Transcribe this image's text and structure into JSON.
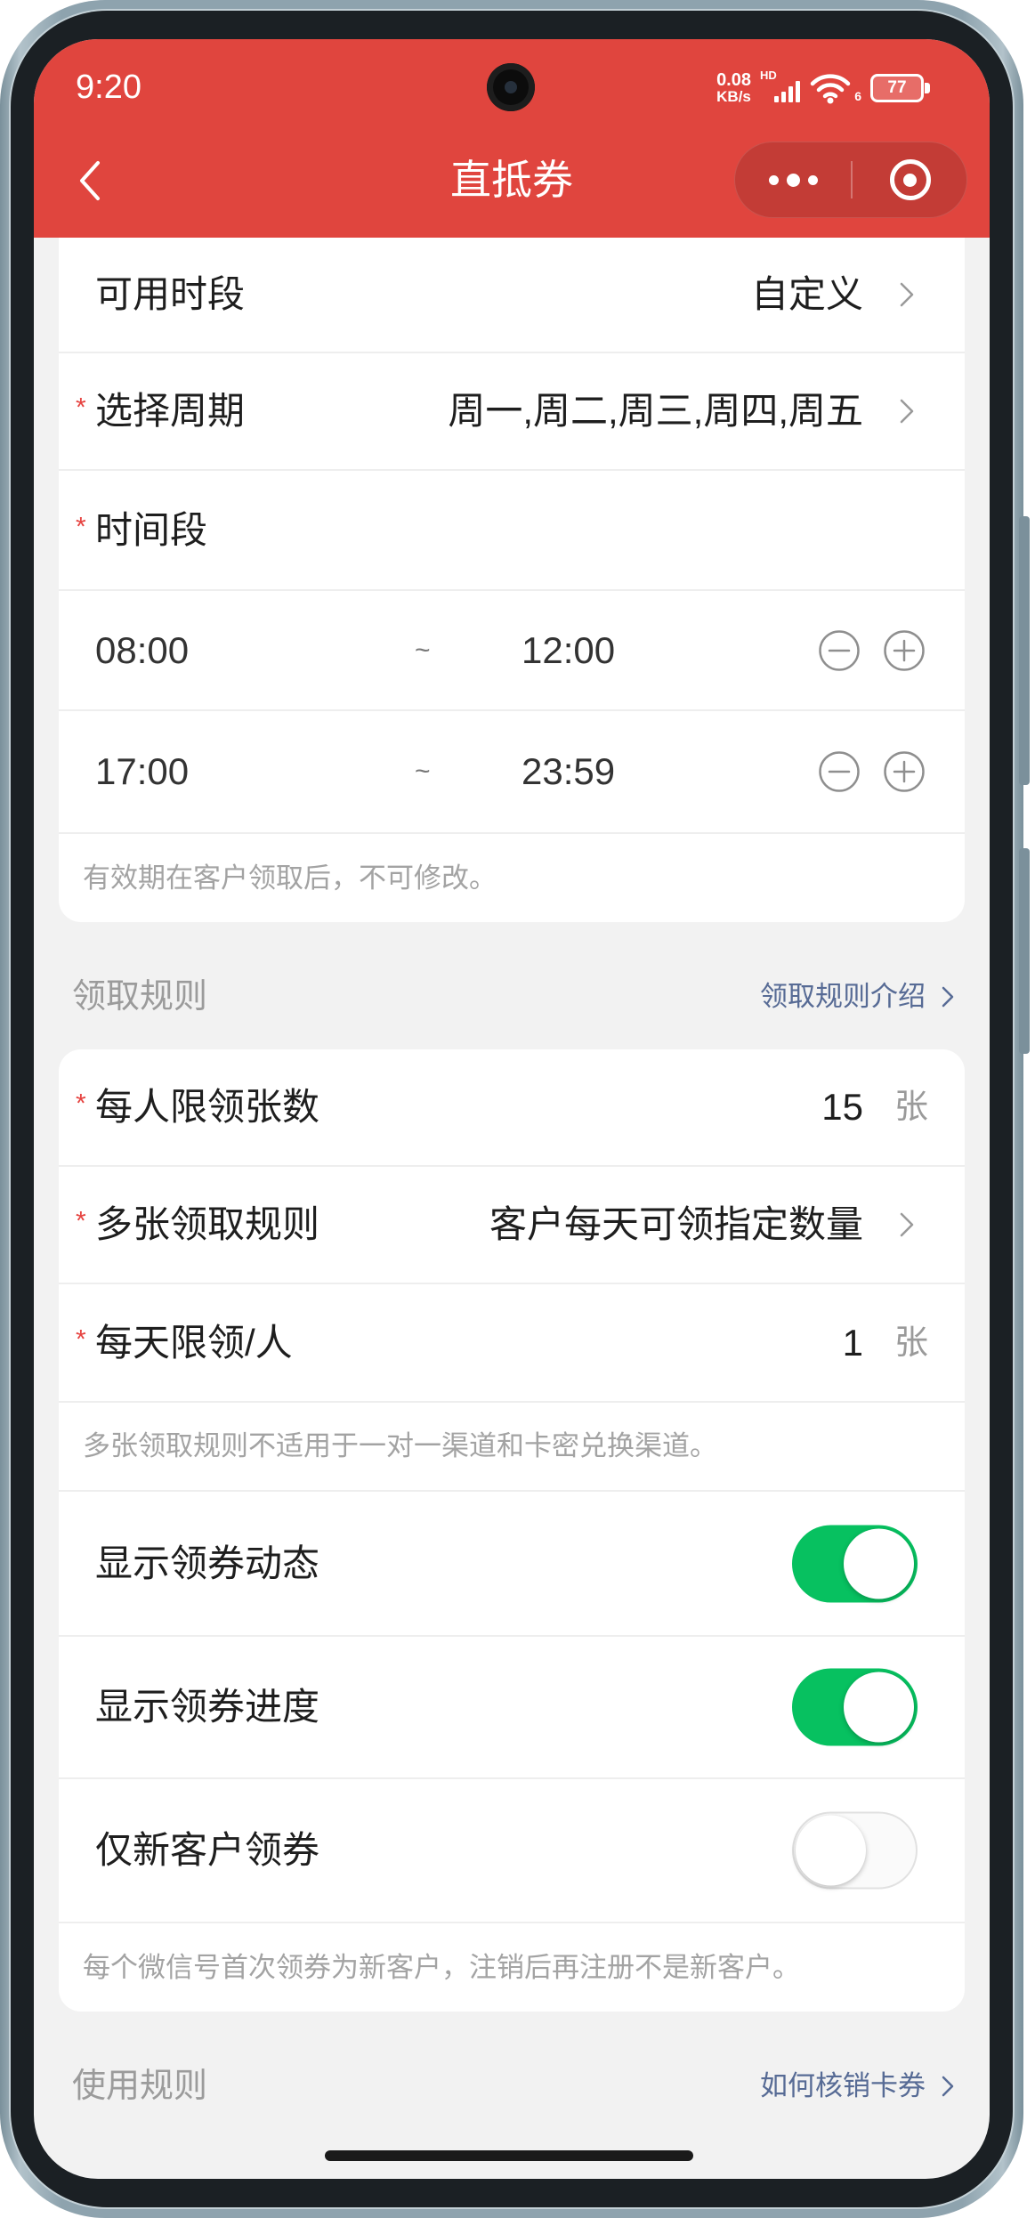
{
  "colors": {
    "header_red": "#e0453e",
    "toggle_on": "#07c160",
    "link": "#576b95",
    "required": "#e64340"
  },
  "status_bar": {
    "time": "9:20",
    "net_speed": "0.08",
    "net_unit": "KB/s",
    "hd_label": "HD",
    "wifi_label": "6",
    "battery": "77"
  },
  "nav": {
    "title": "直抵券",
    "back_icon": "chevron-left-icon",
    "more_icon": "more-dots-icon",
    "close_icon": "target-circle-icon"
  },
  "validity_card": {
    "available_period": {
      "label": "可用时段",
      "value": "自定义"
    },
    "cycle": {
      "required_mark": "*",
      "label": "选择周期",
      "value": "周一,周二,周三,周四,周五"
    },
    "time_slot": {
      "required_mark": "*",
      "label": "时间段"
    },
    "time_ranges": [
      {
        "start": "08:00",
        "separator": "~",
        "end": "12:00"
      },
      {
        "start": "17:00",
        "separator": "~",
        "end": "23:59"
      }
    ],
    "note": "有效期在客户领取后，不可修改。"
  },
  "claim_rules": {
    "title": "领取规则",
    "link": "领取规则介绍",
    "per_person_limit": {
      "required_mark": "*",
      "label": "每人限领张数",
      "value": "15",
      "unit": "张"
    },
    "multi_rule": {
      "required_mark": "*",
      "label": "多张领取规则",
      "value": "客户每天可领指定数量"
    },
    "daily_limit": {
      "required_mark": "*",
      "label": "每天限领/人",
      "value": "1",
      "unit": "张"
    },
    "multi_note": "多张领取规则不适用于一对一渠道和卡密兑换渠道。",
    "toggles": [
      {
        "label": "显示领券动态",
        "on": true
      },
      {
        "label": "显示领券进度",
        "on": true
      },
      {
        "label": "仅新客户领券",
        "on": false
      }
    ],
    "new_customer_note": "每个微信号首次领券为新客户，注销后再注册不是新客户。"
  },
  "usage_rules": {
    "title": "使用规则",
    "link": "如何核销卡券"
  }
}
